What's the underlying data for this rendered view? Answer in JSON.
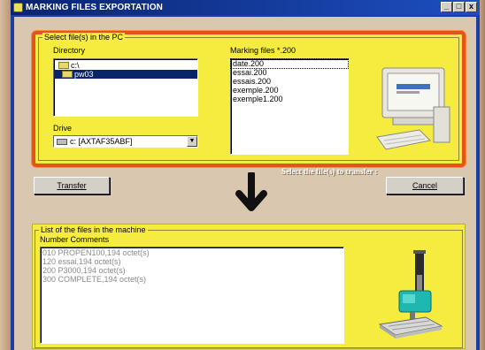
{
  "window": {
    "title": "MARKING FILES EXPORTATION",
    "buttons": [
      "_",
      "□",
      "x"
    ]
  },
  "select_group": {
    "legend": "Select file(s) in the PC",
    "directory": {
      "label": "Directory",
      "items": [
        {
          "label": "c:\\",
          "selected": false
        },
        {
          "label": "pw03",
          "selected": true
        }
      ]
    },
    "drive": {
      "label": "Drive",
      "value": "c: [AXTAF35ABF]"
    },
    "marking_files": {
      "label": "Marking files *.200",
      "items": [
        "date.200",
        "essai.200",
        "essais.200",
        "exemple.200",
        "exemple1.200"
      ]
    }
  },
  "hint_text": "Select the file(s) to transfer :",
  "transfer_button": "Transfer",
  "cancel_button": "Cancel",
  "machine_group": {
    "legend": "List of the files in the machine",
    "header": "Number Comments",
    "items": [
      "010  PROPEN100,194 octet(s)",
      "120  essai,194 octet(s)",
      "200  P3000,194 octet(s)",
      "300  COMPLETE,194 octet(s)"
    ]
  },
  "colors": {
    "panel_yellow": "#f6ec40",
    "panel_border": "#e2541a",
    "title_bar": "#0a2470",
    "selection": "#0a246a"
  },
  "icons": {
    "arrow": "down-arrow-icon",
    "pc": "desktop-computer-icon",
    "machine": "marking-machine-icon"
  }
}
